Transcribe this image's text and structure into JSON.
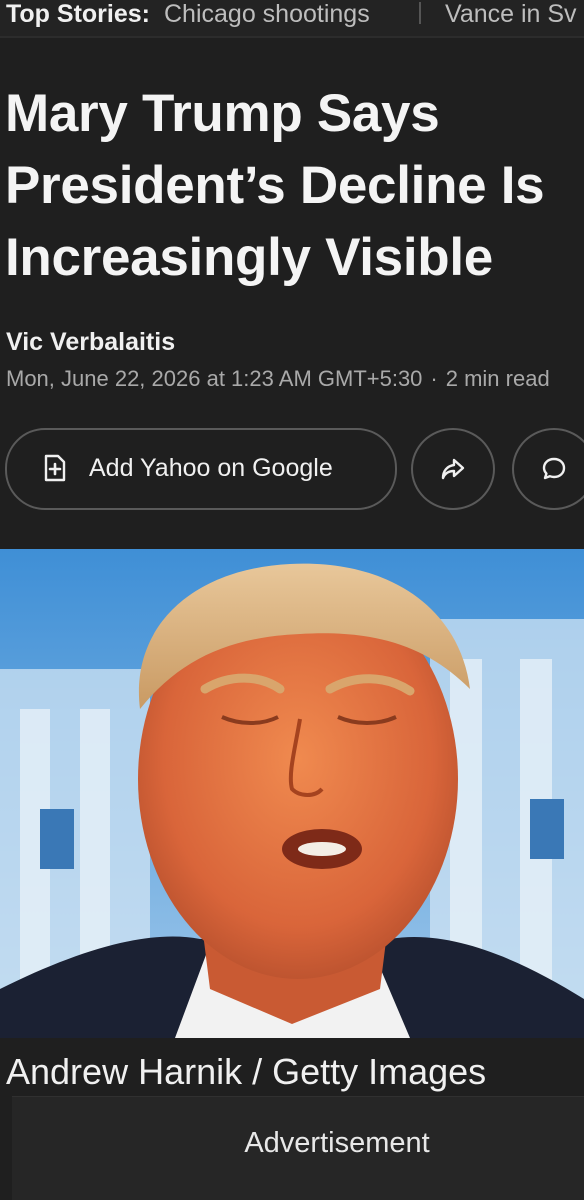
{
  "top_stories": {
    "label": "Top Stories:",
    "items": [
      "Chicago shootings",
      "Vance in Sv"
    ]
  },
  "article": {
    "headline_lines": [
      "Mary Trump Says",
      "President’s Decline Is",
      "Increasingly Visible"
    ],
    "author": "Vic Verbalaitis",
    "date": "Mon, June 22, 2026 at 1:23 AM GMT+5:30",
    "separator": "·",
    "read_time": "2 min read"
  },
  "actions": {
    "google_label": "Add Yahoo on Google",
    "google_icon": "add-document-icon",
    "share_icon": "share-arrow-icon",
    "comment_icon": "comment-bubble-icon"
  },
  "photo": {
    "caption": "Andrew Harnik / Getty Images"
  },
  "advertisement": {
    "label": "Advertisement"
  },
  "colors": {
    "background": "#1f1f1f",
    "text": "#f2f2f2",
    "muted": "#a9a9a9",
    "border": "#5a5a5a"
  }
}
